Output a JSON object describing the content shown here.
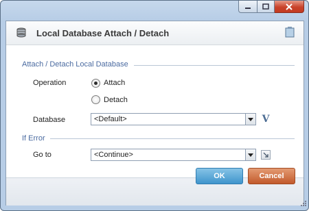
{
  "window": {
    "caption_buttons": [
      "minimize",
      "maximize",
      "close"
    ]
  },
  "header": {
    "title": "Local Database Attach / Detach",
    "icon": "database-stack-icon",
    "note_icon": "note-icon"
  },
  "attach_section": {
    "title": "Attach / Detach Local Database",
    "operation_label": "Operation",
    "options": [
      {
        "label": "Attach",
        "checked": true
      },
      {
        "label": "Detach",
        "checked": false
      }
    ],
    "database_label": "Database",
    "database_value": "<Default>",
    "variable_button": "V"
  },
  "error_section": {
    "title": "If Error",
    "goto_label": "Go to",
    "goto_value": "<Continue>"
  },
  "footer": {
    "ok_label": "OK",
    "cancel_label": "Cancel"
  },
  "colors": {
    "ok_button": "#3f95cc",
    "cancel_button": "#c25a2c",
    "section_title": "#4a6aa0"
  }
}
